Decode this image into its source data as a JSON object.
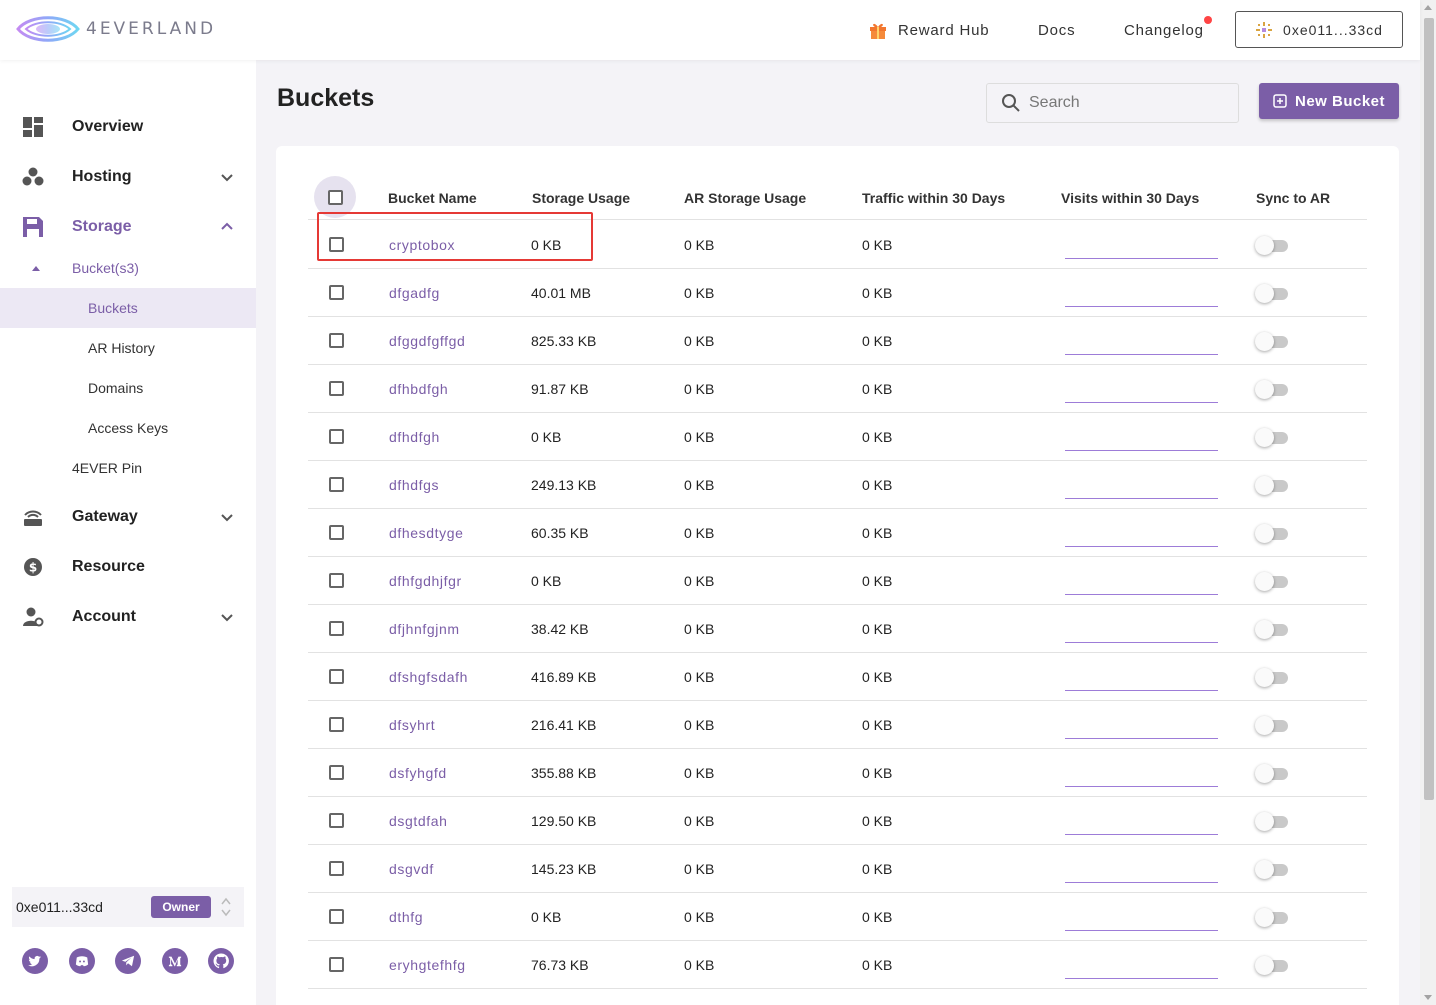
{
  "brand": {
    "logo_text": "4EVERLAND"
  },
  "topnav": {
    "reward_hub": "Reward Hub",
    "docs": "Docs",
    "changelog": "Changelog",
    "wallet": "0xe011...33cd"
  },
  "sidebar": {
    "overview": "Overview",
    "hosting": "Hosting",
    "storage": "Storage",
    "bucket_s3": "Bucket(s3)",
    "buckets": "Buckets",
    "ar_history": "AR History",
    "domains": "Domains",
    "access_keys": "Access Keys",
    "pin": "4EVER Pin",
    "gateway": "Gateway",
    "resource": "Resource",
    "account": "Account",
    "account_addr": "0xe011...33cd",
    "owner_badge": "Owner"
  },
  "main": {
    "title": "Buckets",
    "search_placeholder": "Search",
    "new_bucket": "New Bucket"
  },
  "table": {
    "headers": {
      "name": "Bucket Name",
      "storage": "Storage Usage",
      "ar_storage": "AR Storage Usage",
      "traffic": "Traffic within 30 Days",
      "visits": "Visits within 30 Days",
      "sync": "Sync to AR"
    },
    "rows": [
      {
        "name": "cryptobox",
        "storage": "0 KB",
        "ar": "0 KB",
        "traffic": "0 KB"
      },
      {
        "name": "dfgadfg",
        "storage": "40.01 MB",
        "ar": "0 KB",
        "traffic": "0 KB"
      },
      {
        "name": "dfggdfgffgd",
        "storage": "825.33 KB",
        "ar": "0 KB",
        "traffic": "0 KB"
      },
      {
        "name": "dfhbdfgh",
        "storage": "91.87 KB",
        "ar": "0 KB",
        "traffic": "0 KB"
      },
      {
        "name": "dfhdfgh",
        "storage": "0 KB",
        "ar": "0 KB",
        "traffic": "0 KB"
      },
      {
        "name": "dfhdfgs",
        "storage": "249.13 KB",
        "ar": "0 KB",
        "traffic": "0 KB"
      },
      {
        "name": "dfhesdtyge",
        "storage": "60.35 KB",
        "ar": "0 KB",
        "traffic": "0 KB"
      },
      {
        "name": "dfhfgdhjfgr",
        "storage": "0 KB",
        "ar": "0 KB",
        "traffic": "0 KB"
      },
      {
        "name": "dfjhnfgjnm",
        "storage": "38.42 KB",
        "ar": "0 KB",
        "traffic": "0 KB"
      },
      {
        "name": "dfshgfsdafh",
        "storage": "416.89 KB",
        "ar": "0 KB",
        "traffic": "0 KB"
      },
      {
        "name": "dfsyhrt",
        "storage": "216.41 KB",
        "ar": "0 KB",
        "traffic": "0 KB"
      },
      {
        "name": "dsfyhgfd",
        "storage": "355.88 KB",
        "ar": "0 KB",
        "traffic": "0 KB"
      },
      {
        "name": "dsgtdfah",
        "storage": "129.50 KB",
        "ar": "0 KB",
        "traffic": "0 KB"
      },
      {
        "name": "dsgvdf",
        "storage": "145.23 KB",
        "ar": "0 KB",
        "traffic": "0 KB"
      },
      {
        "name": "dthfg",
        "storage": "0 KB",
        "ar": "0 KB",
        "traffic": "0 KB"
      },
      {
        "name": "eryhgtefhfg",
        "storage": "76.73 KB",
        "ar": "0 KB",
        "traffic": "0 KB"
      }
    ]
  },
  "colors": {
    "accent": "#7b5ea7",
    "highlight": "#e53935"
  }
}
